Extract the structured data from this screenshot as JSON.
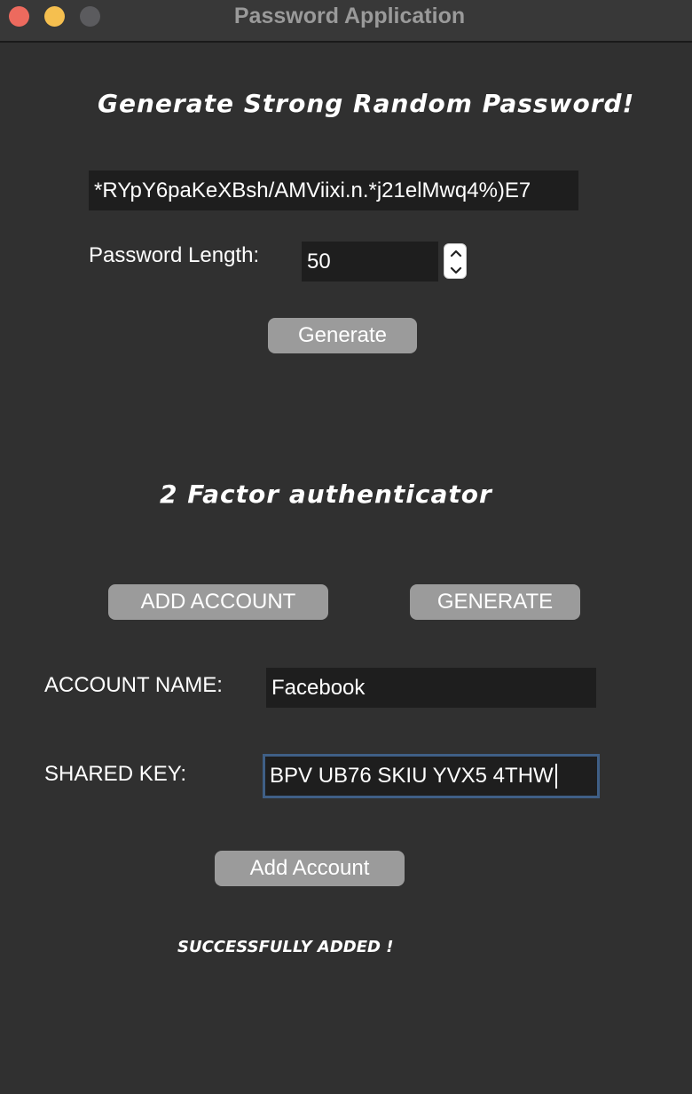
{
  "window": {
    "title": "Password Application"
  },
  "generator": {
    "heading": "Generate Strong Random Password!",
    "password_value": "*RYpY6paKeXBsh/AMViixi.n.*j21elMwq4%)E7",
    "length_label": "Password Length:",
    "length_value": "50",
    "generate_label": "Generate"
  },
  "two_factor": {
    "heading": "2 Factor authenticator",
    "add_account_tab_label": "ADD ACCOUNT",
    "generate_tab_label": "GENERATE",
    "account_name_label": "ACCOUNT NAME:",
    "account_name_value": "Facebook",
    "shared_key_label": "SHARED KEY:",
    "shared_key_value": "BPV UB76 SKIU YVX5 4THW",
    "add_account_button_label": "Add Account",
    "status_message": "SUCCESSFULLY ADDED !"
  },
  "colors": {
    "background": "#303030",
    "field_background": "#1e1e1e",
    "button_background": "#9b9b9b",
    "focus_border": "#3f5f86"
  }
}
